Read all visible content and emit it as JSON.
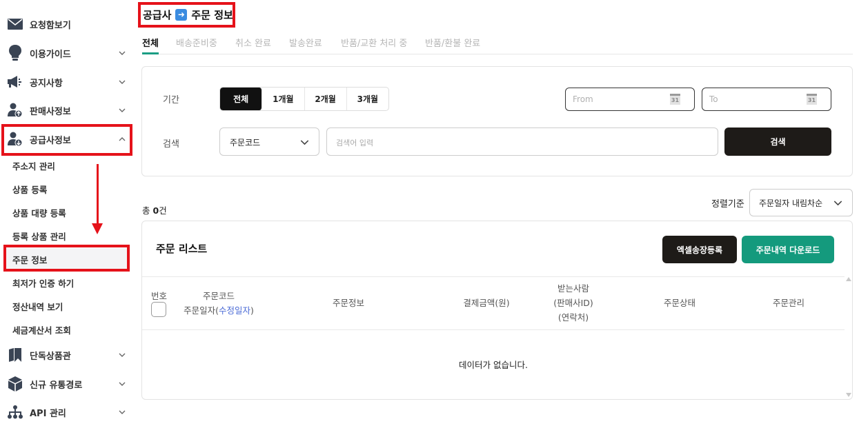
{
  "sidebar": {
    "items": [
      {
        "label": "요청함보기",
        "icon": "envelope-icon"
      },
      {
        "label": "이용가이드",
        "icon": "lightbulb-icon"
      },
      {
        "label": "공지사항",
        "icon": "megaphone-icon"
      },
      {
        "label": "판매사정보",
        "icon": "user-upload-icon"
      },
      {
        "label": "공급사정보",
        "icon": "user-download-icon"
      },
      {
        "label": "단독상품관",
        "icon": "bookmark-icon"
      },
      {
        "label": "신규 유통경로",
        "icon": "box-icon"
      },
      {
        "label": "API 관리",
        "icon": "network-icon"
      }
    ],
    "sub_items": [
      "주소지 관리",
      "상품 등록",
      "상품 대량 등록",
      "등록 상품 관리",
      "주문 정보",
      "최저가 인증 하기",
      "정산내역 보기",
      "세금계산서 조회"
    ]
  },
  "header": {
    "title_left": "공급사",
    "title_right": "주문 정보"
  },
  "tabs": [
    "전체",
    "배송준비중",
    "취소 완료",
    "발송완료",
    "반품/교환 처리 중",
    "반품/환불 완료"
  ],
  "filter": {
    "period_label": "기간",
    "periods": [
      "전체",
      "1개월",
      "2개월",
      "3개월"
    ],
    "from_placeholder": "From",
    "to_placeholder": "To",
    "calendar_day": "31",
    "search_label": "검색",
    "search_type": "주문코드",
    "search_placeholder": "검색어 입력",
    "search_button": "검색"
  },
  "summary": {
    "total_prefix": "총 ",
    "total_count": "0",
    "total_suffix": "건"
  },
  "sort": {
    "label": "정렬기준",
    "value": "주문일자 내림차순"
  },
  "list": {
    "title": "주문 리스트",
    "excel_button": "엑셀송장등록",
    "download_button": "주문내역 다운로드",
    "columns": {
      "number": "번호",
      "code": "주문코드",
      "date_prefix": "주문일자(",
      "date_link": "수정일자",
      "date_suffix": ")",
      "info": "주문정보",
      "amount": "결제금액(원)",
      "recipient_1": "받는사람",
      "recipient_2": "(판매사ID)",
      "recipient_3": "(연락처)",
      "status": "주문상태",
      "manage": "주문관리"
    },
    "empty_text": "데이터가 없습니다."
  },
  "colors": {
    "highlight": "#e5121a",
    "accent_green": "#149a7d",
    "dark_button": "#1e1b18",
    "link_blue": "#4b6bd6"
  }
}
